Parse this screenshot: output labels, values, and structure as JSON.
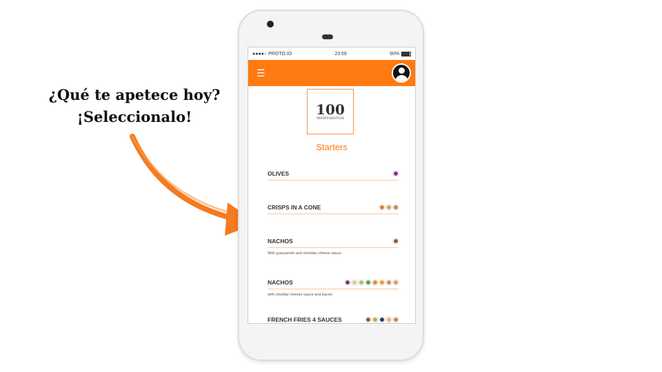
{
  "callout": {
    "line1": "¿Qué te apetece hoy?",
    "line2": "¡Seleccionalo!"
  },
  "status_bar": {
    "carrier": "●●●●○ PROTO.IO",
    "time": "23:59",
    "battery": "90%"
  },
  "logo": {
    "number": "100",
    "name": "MONTADITOS"
  },
  "section_title": "Starters",
  "menu_items": [
    {
      "name": "OLIVES",
      "description": "",
      "icons": [
        "#8a2f7c"
      ]
    },
    {
      "name": "CRISPS IN A CONE",
      "description": "",
      "icons": [
        "#e07a3a",
        "#e8a028",
        "#b8865a"
      ]
    },
    {
      "name": "NACHOS",
      "description": "With guacamole and cheddar cheese sauce",
      "icons": [
        "#8a5a35"
      ]
    },
    {
      "name": "NACHOS",
      "description": "with cheddar cheese sauce and bacon",
      "icons": [
        "#8a2f7c",
        "#d8c8a0",
        "#c8b060",
        "#5aa040",
        "#d89028",
        "#e8a020",
        "#e08a40",
        "#e09a60"
      ]
    },
    {
      "name": "FRENCH FRIES 4 SAUCES",
      "description": "",
      "icons": [
        "#8a5a35",
        "#d0a040",
        "#1a3a6a",
        "#e8b070",
        "#e07a40"
      ]
    }
  ],
  "colors": {
    "accent": "#ff7a10",
    "divider": "#f2c8a8"
  }
}
